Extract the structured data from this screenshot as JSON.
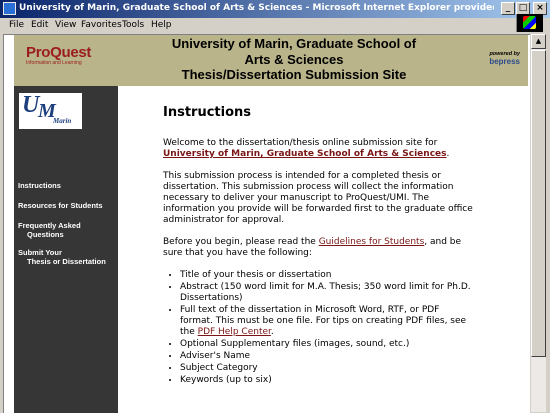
{
  "window": {
    "title": "University of Marin, Graduate School of Arts & Sciences - Microsoft Internet Explorer provided by ProQuest Enterprise Services",
    "minimize": "_",
    "maximize": "□",
    "close": "×"
  },
  "menu": [
    "File",
    "Edit",
    "View",
    "Favorites",
    "Tools",
    "Help"
  ],
  "header": {
    "logo_main": "ProQuest",
    "logo_sub": "Information and Learning",
    "title_line1": "University of Marin, Graduate School of",
    "title_line2": "Arts & Sciences",
    "title_line3": "Thesis/Dissertation Submission Site",
    "powered_by": "powered by",
    "bepress": "bepress"
  },
  "sidebar": {
    "logo_u": "U",
    "logo_m": "M",
    "logo_marin": "Marin",
    "links": [
      {
        "line1": "Instructions"
      },
      {
        "line1": "Resources for Students"
      },
      {
        "line1": "Frequently Asked",
        "line2": "Questions"
      },
      {
        "line1": "Submit Your",
        "line2": "Thesis or Dissertation"
      }
    ]
  },
  "main": {
    "heading": "Instructions",
    "p1_text": "Welcome to the dissertation/thesis online submission site for",
    "p1_link": "University of Marin, Graduate School of Arts & Sciences",
    "p1_end": ".",
    "p2": "This submission process is intended for a completed thesis or dissertation. This submission process will collect the information necessary to deliver your manuscript to ProQuest/UMI. The information you provide will be forwarded first to the graduate office administrator for approval.",
    "p3_pre": "Before you begin, please read the ",
    "p3_link": "Guidelines for Students",
    "p3_post": ", and be sure that you have the following:",
    "list": {
      "item1": "Title of your thesis or dissertation",
      "item2": "Abstract (150 word limit for M.A. Thesis; 350 word limit for Ph.D. Dissertations)",
      "item3_pre": "Full text of the dissertation in Microsoft Word, RTF, or PDF format. This must be one file. For tips on creating PDF files, see the ",
      "item3_link": "PDF Help Center",
      "item3_post": ".",
      "item4": "Optional Supplementary files (images, sound, etc.)",
      "item5": "Adviser's Name",
      "item6": "Subject Category",
      "item7": "Keywords (up to six)"
    }
  },
  "colors": {
    "header_band": "#b9b48a",
    "sidebar": "#363636",
    "link": "#7b1515",
    "titlebar": "#0a246a"
  }
}
